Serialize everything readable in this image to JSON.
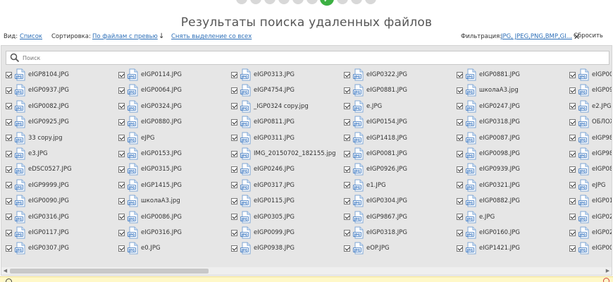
{
  "header": {
    "title": "Результаты поиска удаленных файлов"
  },
  "toolbar": {
    "view_label": "Вид:",
    "view_value": "Список",
    "sort_label": "Сортировка:",
    "sort_value": "По файлам с превью",
    "deselect_label": "Снять выделение со всех",
    "filter_label": "Фильтрация:",
    "filter_value": "JPG, JPEG,PNG,BMP,GI...",
    "reset_label": "Сбросить"
  },
  "search": {
    "placeholder": "Поиск"
  },
  "file_icon_label": "JPG",
  "columns": [
    [
      "eIGP8104.JPG",
      "eIGP0937.JPG",
      "eIGP0082.JPG",
      "eIGP0925.JPG",
      "33 copy.jpg",
      "e3.JPG",
      "eDSC0527.JPG",
      "eIGP9999.JPG",
      "eIGP0090.JPG",
      "eIGP0316.JPG",
      "eIGP0117.JPG",
      "eIGP0307.JPG"
    ],
    [
      "eIGP0114.JPG",
      "eIGP0064.JPG",
      "eIGP0324.JPG",
      "eIGP0880.JPG",
      "eJPG",
      "eIGP0153.JPG",
      "eIGP0315.JPG",
      "eIGP1415.JPG",
      "школаА3.jpg",
      "eIGP0086.JPG",
      "eIGP0316.JPG",
      "e0.JPG"
    ],
    [
      "eIGP0313.JPG",
      "eIGP4754.JPG",
      "_IGP0324 copy.jpg",
      "eIGP0811.JPG",
      "eIGP0311.JPG",
      "IMG_20150702_182155.jpg",
      "eIGP0246.JPG",
      "eIGP0317.JPG",
      "eIGP0115.JPG",
      "eIGP0305.JPG",
      "eIGP0099.JPG",
      "eIGP0938.JPG"
    ],
    [
      "eIGP0322.JPG",
      "eIGP0881.JPG",
      "e.JPG",
      "eIGP0154.JPG",
      "eIGP1418.JPG",
      "eIGP0081.JPG",
      "eIGP0926.JPG",
      "e1.JPG",
      "eIGP0304.JPG",
      "eIGP9867.JPG",
      "eIGP0318.JPG",
      "eOP.JPG"
    ],
    [
      "eIGP0881.JPG",
      "школаА3.jpg",
      "eIGP0247.JPG",
      "eIGP0318.JPG",
      "eIGP0087.JPG",
      "eIGP0098.JPG",
      "eIGP0939.JPG",
      "eIGP0321.JPG",
      "eIGP0882.JPG",
      "e.JPG",
      "eIGP0160.JPG",
      "eIGP1421.JPG"
    ],
    [
      "eIGP00",
      "eIGP09",
      "e2.JPG",
      "ОБЛОЖ",
      "eIGP98",
      "eIGP98",
      "eIGP08",
      "eJPG",
      "eIGP01",
      "eIGP02",
      "eIGP02",
      "eIGP00"
    ]
  ]
}
